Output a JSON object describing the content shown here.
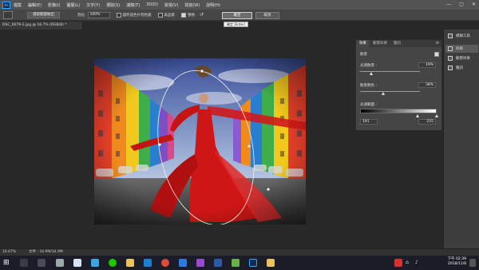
{
  "menu": [
    "檔案",
    "編輯(E)",
    "影像(I)",
    "圖層(L)",
    "文字(Y)",
    "選取(S)",
    "濾鏡(T)",
    "3D(D)",
    "檢視(V)",
    "視窗(W)",
    "說明(H)"
  ],
  "options": {
    "select_focus_button": "選取範圍輸出",
    "feather_label": "羽化:",
    "feather_value": "100%",
    "check1_label": "儲存遮色片到色版",
    "check2_label": "高品質",
    "check3_label": "預視",
    "ok": "確定",
    "cancel": "取消",
    "ok_tooltip": "確定 (Enter)"
  },
  "document": {
    "tab": "DSC_6679-2.jpg @ 16.7% (RGB/8) *",
    "zoom": "16.67%",
    "doc_size": "文件 : 34.9M/34.9M"
  },
  "properties": {
    "tabs": [
      "效果",
      "動態效果",
      "雜訊"
    ],
    "effects_label": "散景",
    "light_bokeh_label": "光源散景 :",
    "light_bokeh_value": "19%",
    "bokeh_color_label": "散景顏色 :",
    "bokeh_color_value": "38%",
    "light_range_label": "光源範圍 :",
    "range_low": "191",
    "range_high": "255",
    "light_bokeh_level": 0.19,
    "bokeh_color_level": 0.38,
    "range_low_level": 0.75,
    "range_high_level": 1.0
  },
  "dock": {
    "items": [
      "模糊工具",
      "效果",
      "動態效果",
      "雜訊"
    ]
  },
  "taskbar": {
    "time": "下午 02:39",
    "date": "2018/11/8"
  },
  "colors": {
    "accent": "#31a8ff",
    "ui_dark": "#282828",
    "dress_red": "#d11a1a"
  }
}
